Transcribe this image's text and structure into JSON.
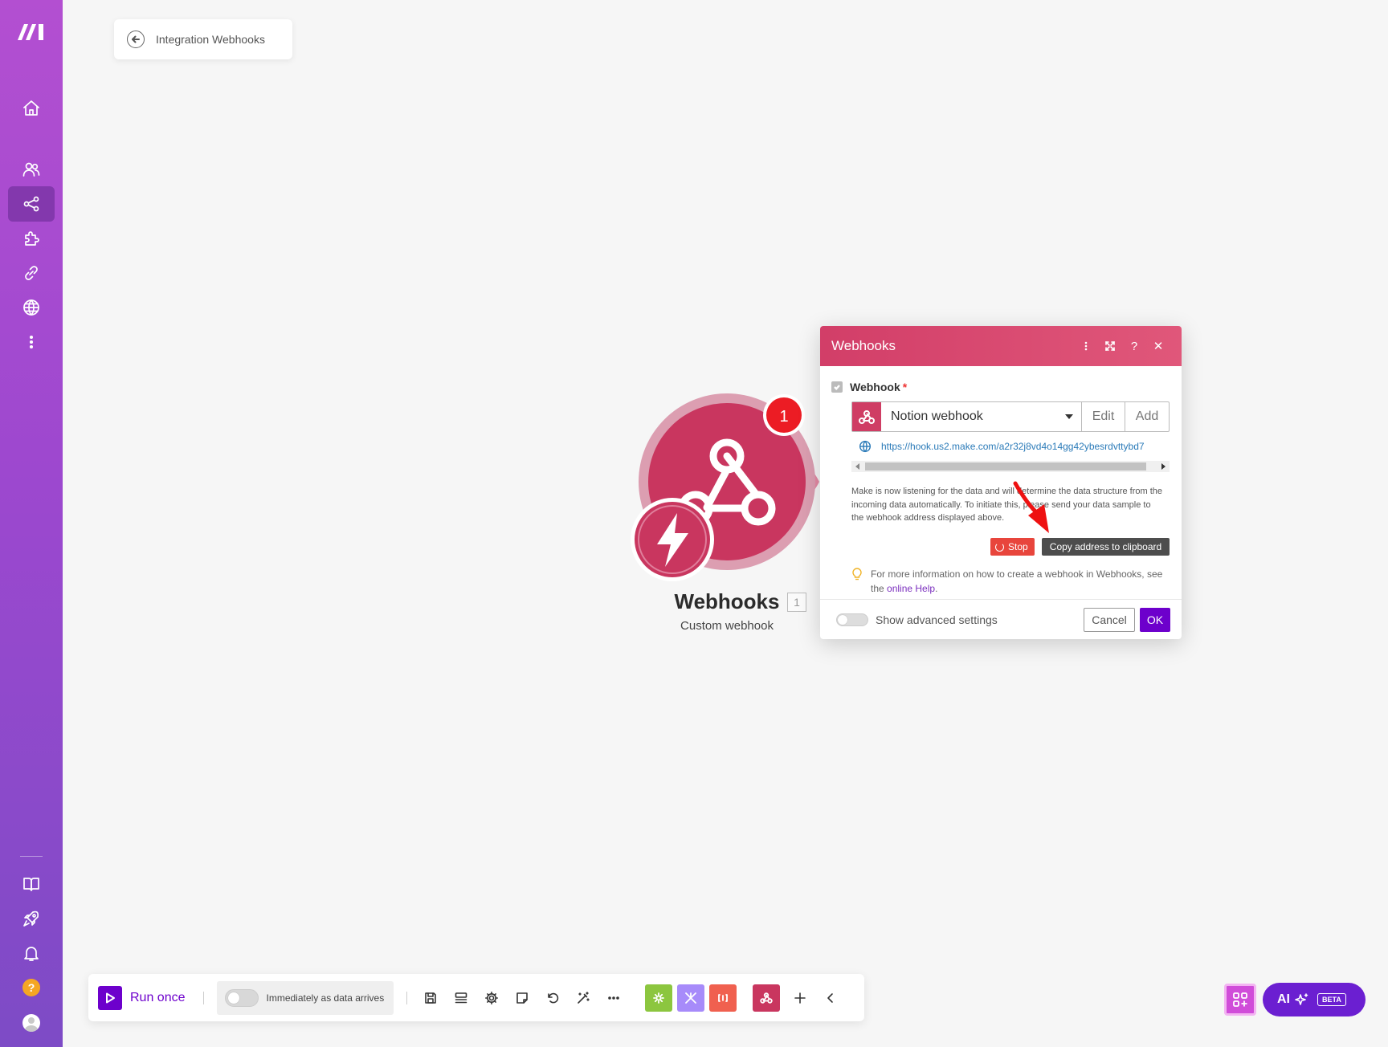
{
  "breadcrumb": {
    "title": "Integration Webhooks",
    "back_icon": "arrow-left-icon"
  },
  "sidebar": {
    "items": [
      {
        "name": "home",
        "icon": "home-icon"
      },
      {
        "name": "team",
        "icon": "users-icon"
      },
      {
        "name": "scenarios",
        "icon": "share-nodes-icon",
        "active": true
      },
      {
        "name": "custom-apps",
        "icon": "puzzle-icon"
      },
      {
        "name": "connections",
        "icon": "link-icon"
      },
      {
        "name": "webhooks",
        "icon": "globe-icon"
      },
      {
        "name": "more",
        "icon": "dots-vertical-icon"
      },
      {
        "name": "docs",
        "icon": "book-icon"
      },
      {
        "name": "whats-new",
        "icon": "rocket-icon"
      },
      {
        "name": "notifications",
        "icon": "bell-icon"
      },
      {
        "name": "help",
        "icon": "help-icon",
        "text": "?"
      },
      {
        "name": "profile",
        "icon": "avatar-icon"
      }
    ]
  },
  "module": {
    "title": "Webhooks",
    "count": "1",
    "subtitle": "Custom webhook",
    "badge": "1",
    "color": "#c9365f"
  },
  "dialog": {
    "title": "Webhooks",
    "header_icons": [
      "more-vertical-icon",
      "expand-icon",
      "help-icon",
      "close-icon"
    ],
    "help_glyph": "?",
    "close_glyph": "✕",
    "field_label": "Webhook",
    "required_mark": "*",
    "select_value": "Notion webhook",
    "edit_label": "Edit",
    "add_label": "Add",
    "url": "https://hook.us2.make.com/a2r32j8vd4o14gg42ybesrdvttybd7",
    "info_text": "Make is now listening for the data and will determine the data structure from the incoming data automatically. To initiate this, please send your data sample to the webhook address displayed above.",
    "stop_label": "Stop",
    "copy_label": "Copy address to clipboard",
    "tip_prefix": "For more information on how to create a webhook in Webhooks, see the ",
    "tip_link": "online Help",
    "tip_suffix": ".",
    "advanced_label": "Show advanced settings",
    "cancel_label": "Cancel",
    "ok_label": "OK",
    "header_color": "#d23e68"
  },
  "toolbar": {
    "run_label": "Run once",
    "schedule_label": "Immediately as data arrives",
    "icons": [
      "save-icon",
      "layout-icon",
      "gear-icon",
      "note-icon",
      "undo-icon",
      "magic-wand-icon",
      "more-horizontal-icon"
    ],
    "tool_buttons": [
      {
        "icon": "tools-gear-icon",
        "color": "#8cc63f"
      },
      {
        "icon": "flow-control-icon",
        "color": "#a78bfa"
      },
      {
        "icon": "text-parser-icon",
        "color": "#f0604f"
      },
      {
        "icon": "webhook-icon",
        "color": "#c9365f"
      }
    ],
    "add_icon": "plus-icon",
    "collapse_icon": "chevron-left-icon"
  },
  "bottom_right": {
    "apps_icon": "apps-icon",
    "ai_label": "AI",
    "ai_icon": "sparkle-icon",
    "beta_label": "BETA"
  },
  "colors": {
    "accent": "#6d00cc",
    "brand_gradient_top": "#b34fd1",
    "canvas": "#f6f6f6"
  }
}
